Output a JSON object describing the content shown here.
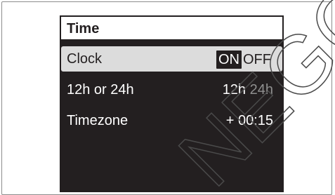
{
  "screen": {
    "title": "Time",
    "rows": [
      {
        "label": "Clock",
        "options": [
          {
            "text": "ON",
            "active": true
          },
          {
            "text": "OFF",
            "active": false
          }
        ]
      },
      {
        "label": "12h or 24h",
        "options": [
          {
            "text": "12h",
            "active": true
          },
          {
            "text": "24h",
            "active": false
          }
        ]
      },
      {
        "label": "Timezone",
        "value": "+ 00:15"
      }
    ]
  },
  "watermark": {
    "text": "NEGO"
  },
  "colors": {
    "screen_background": "#231f20",
    "selected_row": "#dcdcdc",
    "inactive_option": "#8f8f8f",
    "watermark": "#4a4a4a"
  }
}
